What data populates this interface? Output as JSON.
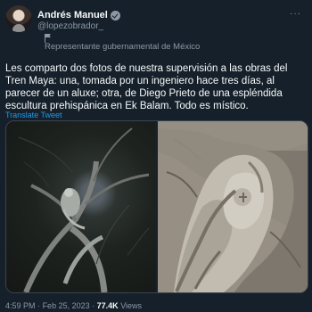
{
  "author": {
    "name": "Andrés Manuel",
    "handle": "@lopezobrador_",
    "label": "Representante gubernamental de México"
  },
  "header": {
    "more": "···"
  },
  "tweet": {
    "text": "Les comparto dos fotos de nuestra supervisión a las obras del Tren Maya: una, tomada por un ingeniero hace tres días, al parecer de un aluxe; otra, de Diego Prieto de una espléndida escultura prehispánica en Ek Balam. Todo es místico.",
    "translate_label": "Translate Tweet"
  },
  "meta": {
    "time": "4:59 PM",
    "sep1": "·",
    "date": "Feb 25, 2023",
    "sep2": "·",
    "views": "77.4K",
    "views_label": "Views"
  },
  "colors": {
    "background": "#15202b",
    "link": "#1d9bf0",
    "muted": "#8b98a5"
  }
}
